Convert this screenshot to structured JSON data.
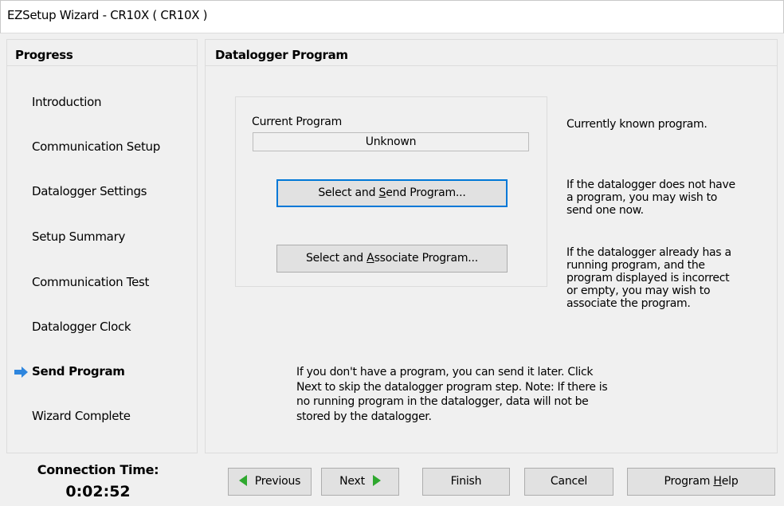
{
  "window": {
    "title": "EZSetup Wizard - CR10X ( CR10X )"
  },
  "progress": {
    "heading": "Progress",
    "steps": [
      {
        "label": "Introduction"
      },
      {
        "label": "Communication Setup"
      },
      {
        "label": "Datalogger Settings"
      },
      {
        "label": "Setup Summary"
      },
      {
        "label": "Communication Test"
      },
      {
        "label": "Datalogger Clock"
      },
      {
        "label": "Send Program",
        "current": true
      },
      {
        "label": "Wizard Complete"
      }
    ],
    "current_marker_icon": "right-arrow-icon"
  },
  "main": {
    "heading": "Datalogger Program",
    "current_program_label": "Current Program",
    "current_program_value": "Unknown",
    "send_button": {
      "pre": "Select and ",
      "mnemonic": "S",
      "post": "end Program..."
    },
    "associate_button": {
      "pre": "Select and ",
      "mnemonic": "A",
      "post": "ssociate Program..."
    },
    "help_current": "Currently known program.",
    "help_send": [
      "If the datalogger does not have",
      "a program, you may wish to",
      "send one now."
    ],
    "help_associate": [
      "If the datalogger already has a",
      "running program, and the",
      "program displayed is incorrect",
      "or empty, you may wish to",
      "associate the program."
    ],
    "note": [
      "If you don't have a program, you can send it later.  Click",
      "Next to skip the datalogger program step.  Note: If there is",
      "no running program in the datalogger, data will not be",
      "stored by the datalogger."
    ]
  },
  "connection": {
    "label": "Connection Time:",
    "time": "0:02:52"
  },
  "nav": {
    "previous": "Previous",
    "next": "Next",
    "finish": "Finish",
    "cancel": "Cancel",
    "help": {
      "pre": "Program ",
      "mnemonic": "H",
      "post": "elp"
    }
  },
  "colors": {
    "accent_focus": "#0078d7",
    "arrow": "#2e86de",
    "nav_triangle": "#2ea82e"
  }
}
